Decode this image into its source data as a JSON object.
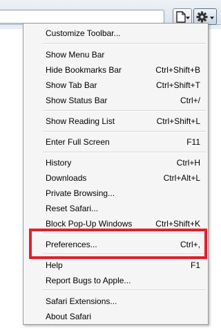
{
  "menu": {
    "groups": [
      [
        {
          "label": "Customize Toolbar...",
          "shortcut": ""
        }
      ],
      [
        {
          "label": "Show Menu Bar",
          "shortcut": ""
        },
        {
          "label": "Hide Bookmarks Bar",
          "shortcut": "Ctrl+Shift+B"
        },
        {
          "label": "Show Tab Bar",
          "shortcut": "Ctrl+Shift+T"
        },
        {
          "label": "Show Status Bar",
          "shortcut": "Ctrl+/"
        }
      ],
      [
        {
          "label": "Show Reading List",
          "shortcut": "Ctrl+Shift+L"
        }
      ],
      [
        {
          "label": "Enter Full Screen",
          "shortcut": "F11"
        }
      ],
      [
        {
          "label": "History",
          "shortcut": "Ctrl+H"
        },
        {
          "label": "Downloads",
          "shortcut": "Ctrl+Alt+L"
        },
        {
          "label": "Private Browsing...",
          "shortcut": ""
        },
        {
          "label": "Reset Safari...",
          "shortcut": ""
        },
        {
          "label": "Block Pop-Up Windows",
          "shortcut": "Ctrl+Shift+K"
        }
      ],
      [
        {
          "label": "Preferences...",
          "shortcut": "Ctrl+,"
        }
      ],
      [
        {
          "label": "Help",
          "shortcut": "F1"
        },
        {
          "label": "Report Bugs to Apple...",
          "shortcut": ""
        }
      ],
      [
        {
          "label": "Safari Extensions...",
          "shortcut": ""
        },
        {
          "label": "About Safari",
          "shortcut": ""
        }
      ]
    ]
  },
  "toolbar": {
    "page_icon": "page-icon",
    "settings_icon": "gear-icon"
  },
  "highlight": {
    "target": "Preferences...",
    "color": "#e0202c"
  }
}
